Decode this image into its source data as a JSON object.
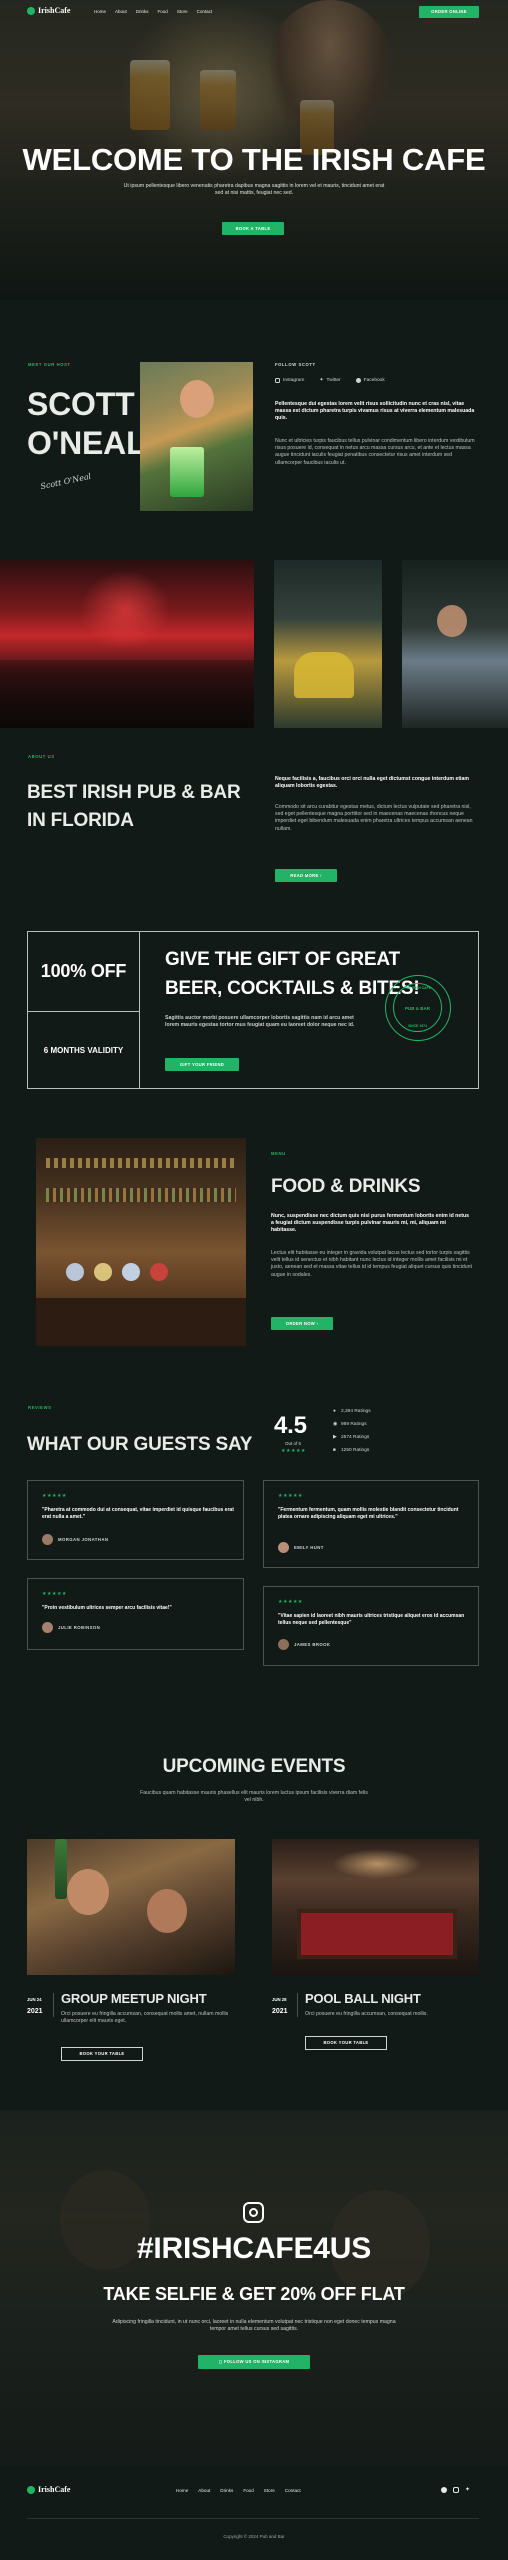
{
  "nav": {
    "brand": "IrishCafe",
    "links": [
      "Home",
      "About",
      "Drinks",
      "Food",
      "Store",
      "Contact"
    ],
    "cta": "ORDER ONLINE"
  },
  "hero": {
    "title": "WELCOME TO THE IRISH CAFE",
    "text": "Ut ipsum pellentesque libero venenatis pharetra dapibus magna sagittis in lorem vel et mauris, tincidunt amet erat sed at nisi mattis, feugiat nec sed.",
    "button": "BOOK A TABLE"
  },
  "owner": {
    "eyebrow": "MEET OUR HOST",
    "name_line1": "SCOTT",
    "name_line2": "O'NEAL",
    "signature": "Scott O'Neal",
    "follow_label": "FOLLOW SCOTT",
    "socials": [
      "Instagram",
      "Twitter",
      "Facebook"
    ],
    "bold_text": "Pellentesque dui egestas lorem velit risus sollicitudin nunc et cras nisl, vitae massa est dictum pharetra turpis vivamus risus at viverra elementum malesuada quis.",
    "text": "Nunc et ultricies turpis faucibus tellus pulvinar condimentum libero interdum vestibulum risus posuere id, consequat in netus arcu massa cursus arcu, et ante et lectus massa augue tincidunt iaculis feugiat penatibus consectetur risus amet interdum sed ullamcorper faucibus iaculis ut."
  },
  "about": {
    "eyebrow": "ABOUT US",
    "title_line1": "BEST IRISH PUB & BAR",
    "title_line2": "IN FLORIDA",
    "bold_text": "Neque facilisis a, faucibus orci orci nulla eget dictumst congue interdum etiam aliquam lobortis egestas.",
    "text": "Commodo sit arcu curabitur egestas metus, dictum lectus vulputate sed pharetra nisl, sed eget pellentesque magna porttitor sed in maecenas maecenas rhoncus neque imperdiet eget bibendum malesuada enim pharetra ultrices tempus accumsan aenean nullam.",
    "button": "READ MORE"
  },
  "promo": {
    "offer": "100% OFF",
    "validity": "6 MONTHS VALIDITY",
    "title_line1": "GIVE THE GIFT OF GREAT",
    "title_line2": "BEER, COCKTAILS & BITES!",
    "text": "Sagittis auctor morbi posuere ullamcorper lobortis sagittis nam id arcu amet lorem mauris egestas tortor mus feugiat quam eu laoreet dolor neque nec id.",
    "button": "GIFT YOUR FRIEND",
    "badge_top": "THE IRISH CAFE",
    "badge_mid": "PUB & BAR",
    "badge_bottom": "SINCE 1974"
  },
  "menu": {
    "eyebrow": "MENU",
    "title": "FOOD & DRINKS",
    "bold_text": "Nunc, suspendisse nec dictum quis nisi purus fermentum lobortis enim id netus a feugiat dictum suspendisse turpis pulvinar mauris mi, mi, aliquam mi habitasse.",
    "text": "Lectus elit habitasse eu integer in gravida volutpat lacus lectus sed tortor turpis sagittis velit tellus id senectus et nibh habitant nunc lectus id integer mollis amet facilisis mi et justo, aenean sed et massa vitae tellus id id tempus feugiat aliquet cursus quis tincidunt augue in sodales.",
    "button": "ORDER NOW"
  },
  "reviews": {
    "eyebrow": "REVIEWS",
    "title": "WHAT OUR GUESTS SAY",
    "score": "4.5",
    "score_sub": "Out of 5",
    "stats": [
      "2,394 Ratings",
      "989 Ratings",
      "2574 Ratings",
      "1250 Ratings"
    ],
    "items": [
      {
        "quote": "\"Pharetra at commodo dui at consequat, vitae imperdiet id quisque faucibus erat erat nulla a amet.\"",
        "name": "MORGAN JONATHAN"
      },
      {
        "quote": "\"Fermentum fermentum, quam mollis molestie blandit consectetur tincidunt platea ornare adipiscing aliquam eget mi ultrices.\"",
        "name": "EMILY HUNT"
      },
      {
        "quote": "\"Proin vestibulum ultrices semper arcu facilisis vitae!\"",
        "name": "JULIE ROBINSON"
      },
      {
        "quote": "\"Vitae sapien id laoreet nibh mauris ultrices tristique aliquet eros id accumsan tellus neque sed pellentesque\"",
        "name": "JAMES BROOK"
      }
    ]
  },
  "events": {
    "title": "UPCOMING EVENTS",
    "text": "Faucibus quam habitasse mauris phasellus elit mauris lorem luctus ipsum facilisis viverra diam felis vel nibh.",
    "items": [
      {
        "month": "JUN 24",
        "year": "2021",
        "title": "GROUP MEETUP NIGHT",
        "text": "Orci posuere eu fringilla accumsan, consequat mollis amet, nullam mollis ullamcorper elit mauris eget.",
        "button": "BOOK YOUR TABLE"
      },
      {
        "month": "JUN 28",
        "year": "2021",
        "title": "POOL BALL NIGHT",
        "text": "Orci posuere eu fringilla accumsan, consequat mollis.",
        "button": "BOOK YOUR TABLE"
      }
    ]
  },
  "social": {
    "hashtag": "#IRISHCAFE4US",
    "subtitle": "TAKE SELFIE & GET 20% OFF FLAT",
    "text": "Adipiscing fringilla tincidunt, in ut nunc orci, laoreet in nulla elementum volutpat nec tristique non eget donec tempus magna tempor amet tellus cursus sed sagittis.",
    "button": "FOLLOW US ON INSTAGRAM"
  },
  "footer": {
    "brand": "IrishCafe",
    "links": [
      "Home",
      "About",
      "Drinks",
      "Food",
      "Store",
      "Contact"
    ],
    "copyright": "Copyright © 2024 Pub and Bar"
  },
  "colors": {
    "accent": "#22b466",
    "background": "#121a17"
  }
}
